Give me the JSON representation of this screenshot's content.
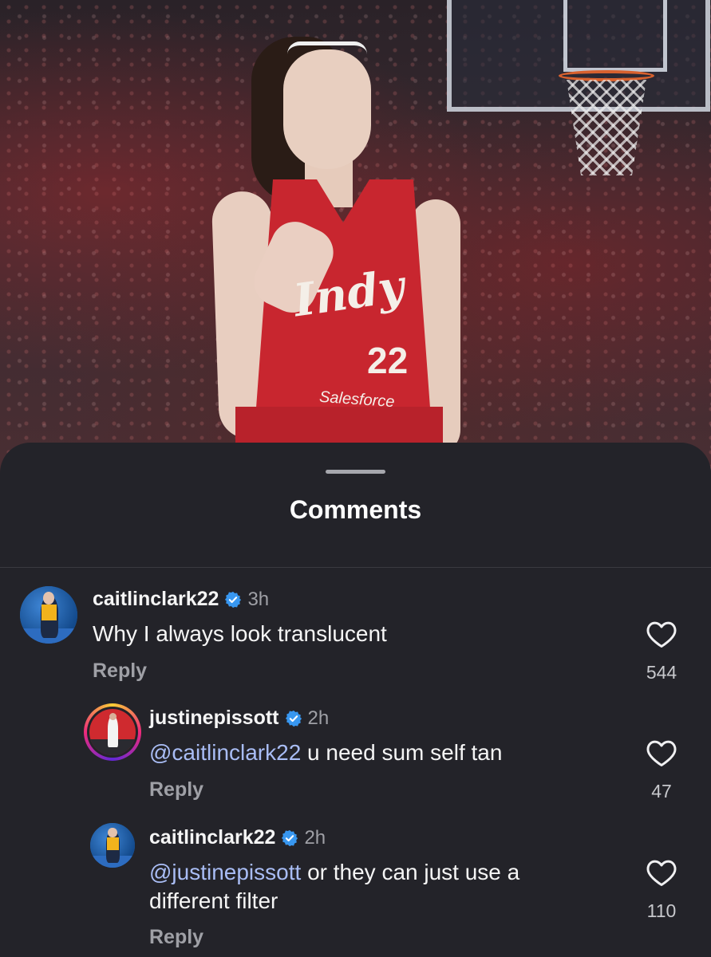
{
  "sheet": {
    "title": "Comments"
  },
  "post_image": {
    "jersey_text": "Indy",
    "jersey_number": "22",
    "jersey_sponsor": "Salesforce"
  },
  "comments": [
    {
      "username": "caitlinclark22",
      "verified": true,
      "time": "3h",
      "mention": "",
      "text": "Why I always look translucent",
      "reply_label": "Reply",
      "likes": "544"
    },
    {
      "username": "justinepissott",
      "verified": true,
      "time": "2h",
      "mention": "@caitlinclark22",
      "text": " u need sum self tan",
      "reply_label": "Reply",
      "likes": "47"
    },
    {
      "username": "caitlinclark22",
      "verified": true,
      "time": "2h",
      "mention": "@justinepissott",
      "text": " or they can just use a",
      "text_line2": "different filter",
      "reply_label": "Reply",
      "likes": "110"
    }
  ],
  "colors": {
    "sheet_bg": "#232329",
    "mention": "#a9bdf5",
    "verified": "#3897f0",
    "secondary_text": "#9fa0a6"
  },
  "icons": {
    "verified": "verified-badge-icon",
    "like": "heart-outline-icon"
  }
}
